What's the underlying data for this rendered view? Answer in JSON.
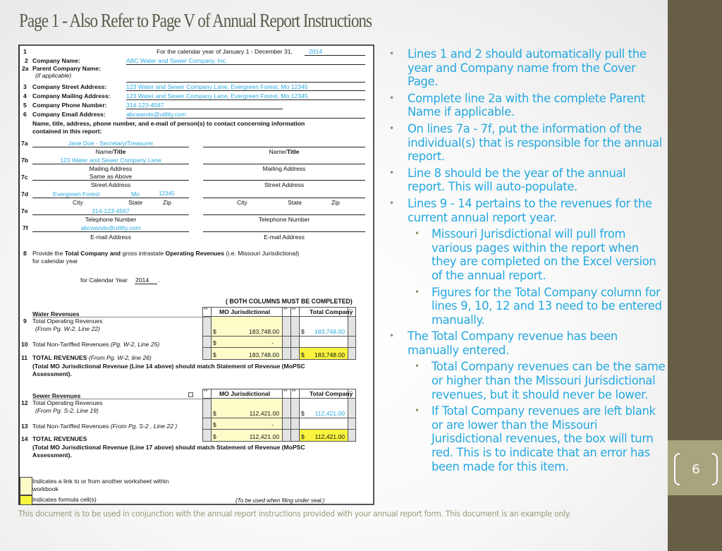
{
  "slide": {
    "title": "Page 1 - Also Refer to Page V of Annual Report Instructions",
    "page_number": "6",
    "footer": "This document is to be used in conjunction with the annual report instructions provided with your annual report form.  This document is an example only.",
    "colors": {
      "accent_text": "#24a8e0",
      "sidebar": "#675e46",
      "sidebar_band": "#a7a47e",
      "formula_cell": "#f8f43f",
      "link_cell": "#fdfcc9"
    }
  },
  "form": {
    "line1": {
      "num": "1",
      "label": "For the calendar year of January 1 - December 31,",
      "value": "2014"
    },
    "line2": {
      "num": "2",
      "label": "Company Name:",
      "value": "ABC Water and Sewer Company, Inc."
    },
    "line2a": {
      "num": "2a",
      "label": "Parent Company Name:",
      "sublabel": "(if applicable)",
      "value": ""
    },
    "line3": {
      "num": "3",
      "label": "Company Street Address:",
      "value": "123 Water and Sewer Company Lane, Evergreen Forest, Mo 12345"
    },
    "line4": {
      "num": "4",
      "label": "Company Mailing Address:",
      "value": "123 Water and Sewer Company Lane, Evergreen Forest, Mo 12345"
    },
    "line5": {
      "num": "5",
      "label": "Company Phone Number:",
      "value": "314-123-4567"
    },
    "line6": {
      "num": "6",
      "label": "Company Email Address:",
      "value": "abcwands@utility.com"
    },
    "contact_intro": "Name, title, address, phone number, and e-mail of person(s) to contact concerning information",
    "contact_intro2": "contained in this report:",
    "contact": {
      "nums": [
        "7a",
        "7b",
        "7c",
        "7d",
        "7e",
        "7f"
      ],
      "name_title": "Jane Doe - Secretary/Treasurer",
      "mailing": "123 Water and Sewer Company Lane",
      "street": "Same as Above",
      "city": "Evergreen Forest",
      "state": "Mo",
      "zip": "12345",
      "phone": "314-123-4567",
      "email": "abcwands@utility.com",
      "captions": {
        "name_pre": "Name/",
        "name_bold": "Title",
        "mailing": "Mailing Address",
        "street": "Street Address",
        "city": "City",
        "state": "State",
        "zip": "Zip",
        "phone": "Telephone Number",
        "email": "E-mail Address"
      }
    },
    "line8": {
      "num": "8",
      "t1": "Provide the ",
      "t2": "Total Company and",
      "t3": " gross intrastate ",
      "t4": "Operating Revenues",
      "t5": " (i.e. Missouri Jurisdictional)",
      "t6": "for calendar year",
      "year_label": "for Calendar Year",
      "year": "2014",
      "year_end": "."
    },
    "both_columns_note": "( BOTH COLUMNS MUST BE COMPLETED)",
    "col_headers": {
      "stars": "**",
      "mo": "MO Jurisdictional",
      "total": "Total Company",
      "dash": "--"
    },
    "currency": "$",
    "water": {
      "heading": "Water Revenues",
      "rows": [
        {
          "num": "9",
          "label": "Total Operating Revenues",
          "source": "(From Pg. W-2, Line 22)",
          "mo": "183,748.00",
          "total": "183,748.00"
        },
        {
          "num": "10",
          "label": "Total Non-Tariffed Revenues ",
          "source": "(Pg. W-2, Line 25)",
          "mo": "-",
          "total": ""
        },
        {
          "num": "11",
          "label": "TOTAL REVENUES ",
          "source": "(From Pg. W-2, line 26)",
          "mo": "183,748.00",
          "total": "183,748.00"
        }
      ],
      "note": "(Total MO Jurisdictional Revenue (Line 14 above) should match Statement of Revenue (MoPSC",
      "note2": "Assessment)."
    },
    "sewer": {
      "heading": "Sewer Revenues",
      "rows": [
        {
          "num": "12",
          "label": "Total Operating Revenues",
          "source": "(From Pg. S-2, Line 19)",
          "mo": "112,421.00",
          "total": "112,421.00"
        },
        {
          "num": "13",
          "label": "Total Non-Tariffed Revenues ",
          "source": "(From Pg. S-2 , Line 22 )",
          "mo": "-",
          "total": ""
        },
        {
          "num": "14",
          "label": "TOTAL REVENUES",
          "source": "",
          "mo": "112,421.00",
          "total": "112,421.00"
        }
      ],
      "note": "(Total MO Jurisdictional Revenue (Line 17 above) should match Statement of Revenue (MoPSC",
      "note2": "Assessment)."
    },
    "legend": {
      "link": "Indicates a link to or from another worksheet within",
      "link2": "workbook",
      "formula": "Indicates formula cell(s)",
      "seal_note": "(To be used when filing under seal.)"
    }
  },
  "bullets": [
    {
      "level": 1,
      "text": "Lines 1 and 2 should automatically pull the year and Company name from the Cover Page."
    },
    {
      "level": 1,
      "text": "Complete line 2a with the complete Parent Name if applicable."
    },
    {
      "level": 1,
      "text": "On lines 7a - 7f, put the information of the individual(s) that is responsible for the annual report."
    },
    {
      "level": 1,
      "text": "Line 8 should be the year of the annual report.  This will auto-populate."
    },
    {
      "level": 1,
      "text": "Lines 9 - 14 pertains to the revenues for the current annual report year."
    },
    {
      "level": 2,
      "text": "Missouri Jurisdictional will pull from various pages within the report when they are completed on the Excel version of the annual report."
    },
    {
      "level": 2,
      "text": "Figures for the Total Company column for lines 9, 10, 12 and 13 need to be entered manually."
    },
    {
      "level": 1,
      "text": "The Total Company revenue has been manually entered."
    },
    {
      "level": 2,
      "text": "Total Company revenues can be the same or higher than the Missouri Jurisdictional revenues, but it should never be lower."
    },
    {
      "level": 2,
      "text": "If Total Company revenues are left blank or are lower than the Missouri Jurisdictional revenues, the box will turn red.  This is to indicate that an error has been made for this item."
    }
  ]
}
